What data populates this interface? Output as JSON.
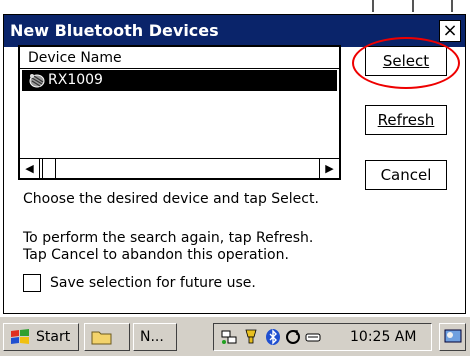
{
  "dialog": {
    "title": "New Bluetooth Devices",
    "close_label": "×"
  },
  "device_list": {
    "header": "Device Name",
    "items": [
      {
        "name": "RX1009",
        "selected": true,
        "icon": "bluetooth-device-icon"
      }
    ],
    "scroll_left": "◀",
    "scroll_right": "▶"
  },
  "buttons": {
    "select_label": "Select",
    "refresh_label": "Refresh",
    "cancel_label": "Cancel"
  },
  "instructions": {
    "line1": "Choose the desired device and tap Select.",
    "line2": "To perform the search again, tap Refresh.",
    "line3": "Tap Cancel to abandon this operation."
  },
  "save_option": {
    "label": "Save selection for future use.",
    "checked": false
  },
  "taskbar": {
    "start_label": "Start",
    "app_label": "N...",
    "time": "10:25 AM"
  },
  "colors": {
    "titlebar": "#0a246a",
    "highlight_circle": "#e00000",
    "taskbar": "#d4d0c8"
  }
}
